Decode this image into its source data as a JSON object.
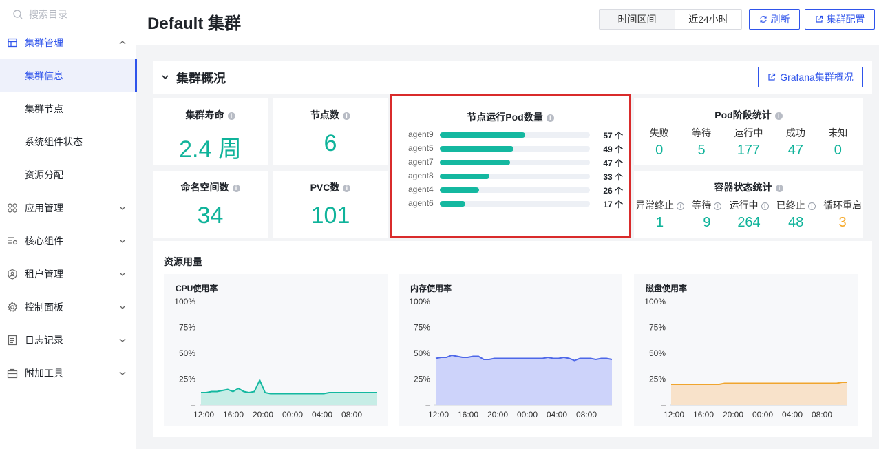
{
  "sidebar": {
    "search_placeholder": "搜索目录",
    "items": [
      {
        "label": "集群管理",
        "icon": "cluster-icon",
        "open": true
      },
      {
        "label": "集群信息",
        "sub": true,
        "active": true
      },
      {
        "label": "集群节点",
        "sub": true
      },
      {
        "label": "系统组件状态",
        "sub": true
      },
      {
        "label": "资源分配",
        "sub": true
      },
      {
        "label": "应用管理",
        "icon": "apps-icon"
      },
      {
        "label": "核心组件",
        "icon": "components-icon"
      },
      {
        "label": "租户管理",
        "icon": "tenant-icon"
      },
      {
        "label": "控制面板",
        "icon": "gear-icon"
      },
      {
        "label": "日志记录",
        "icon": "log-icon"
      },
      {
        "label": "附加工具",
        "icon": "toolbox-icon"
      }
    ]
  },
  "header": {
    "title": "Default 集群",
    "time_label": "时间区间",
    "time_value": "近24小时",
    "refresh": "刷新",
    "config": "集群配置"
  },
  "overview": {
    "title": "集群概况",
    "grafana_button": "Grafana集群概况",
    "tiles": {
      "age": {
        "label": "集群寿命",
        "value": "2.4 周"
      },
      "nodes": {
        "label": "节点数",
        "value": "6"
      },
      "namespaces": {
        "label": "命名空间数",
        "value": "34"
      },
      "pvc": {
        "label": "PVC数",
        "value": "101"
      }
    },
    "node_pods": {
      "title": "节点运行Pod数量",
      "max": 57,
      "rows": [
        {
          "name": "agent9",
          "value": 57,
          "label": "57 个"
        },
        {
          "name": "agent5",
          "value": 49,
          "label": "49 个"
        },
        {
          "name": "agent7",
          "value": 47,
          "label": "47 个"
        },
        {
          "name": "agent8",
          "value": 33,
          "label": "33 个"
        },
        {
          "name": "agent4",
          "value": 26,
          "label": "26 个"
        },
        {
          "name": "agent6",
          "value": 17,
          "label": "17 个"
        }
      ]
    },
    "pod_phase": {
      "title": "Pod阶段统计",
      "items": [
        {
          "label": "失败",
          "value": "0"
        },
        {
          "label": "等待",
          "value": "5"
        },
        {
          "label": "运行中",
          "value": "177"
        },
        {
          "label": "成功",
          "value": "47"
        },
        {
          "label": "未知",
          "value": "0"
        }
      ]
    },
    "container_status": {
      "title": "容器状态统计",
      "items": [
        {
          "label": "异常终止",
          "value": "1",
          "color": "#0fb39a"
        },
        {
          "label": "等待",
          "value": "9",
          "color": "#0fb39a"
        },
        {
          "label": "运行中",
          "value": "264",
          "color": "#0fb39a"
        },
        {
          "label": "已终止",
          "value": "48",
          "color": "#0fb39a"
        },
        {
          "label": "循环重启",
          "value": "3",
          "color": "#f5a623"
        }
      ]
    }
  },
  "resources": {
    "title": "资源用量",
    "y_ticks": [
      "100%",
      "75%",
      "50%",
      "25%",
      "–"
    ],
    "x_ticks": [
      "12:00",
      "16:00",
      "20:00",
      "00:00",
      "04:00",
      "08:00"
    ]
  },
  "chart_data": [
    {
      "type": "area",
      "title": "CPU使用率",
      "ylim": [
        0,
        100
      ],
      "color": "#14b8a0",
      "fill": "#c7ede6",
      "values": [
        12,
        12,
        13,
        13,
        14,
        15,
        13,
        16,
        13,
        12,
        13,
        24,
        12,
        11,
        11,
        11,
        11,
        11,
        11,
        11,
        11,
        11,
        11,
        11,
        12,
        12,
        12,
        12,
        12,
        12,
        12,
        12,
        12,
        12
      ]
    },
    {
      "type": "area",
      "title": "内存使用率",
      "ylim": [
        0,
        100
      ],
      "color": "#4e68e8",
      "fill": "#cdd3fa",
      "values": [
        45,
        46,
        46,
        48,
        47,
        46,
        46,
        47,
        47,
        44,
        44,
        45,
        45,
        45,
        45,
        45,
        45,
        45,
        45,
        45,
        45,
        46,
        45,
        45,
        46,
        45,
        43,
        45,
        45,
        45,
        44,
        45,
        45,
        44
      ]
    },
    {
      "type": "area",
      "title": "磁盘使用率",
      "ylim": [
        0,
        100
      ],
      "color": "#f0a52e",
      "fill": "#f8e2ca",
      "values": [
        20,
        20,
        20,
        20,
        20,
        20,
        20,
        20,
        20,
        20,
        21,
        21,
        21,
        21,
        21,
        21,
        21,
        21,
        21,
        21,
        21,
        21,
        21,
        21,
        21,
        21,
        21,
        21,
        21,
        21,
        21,
        21,
        22,
        22
      ]
    }
  ]
}
